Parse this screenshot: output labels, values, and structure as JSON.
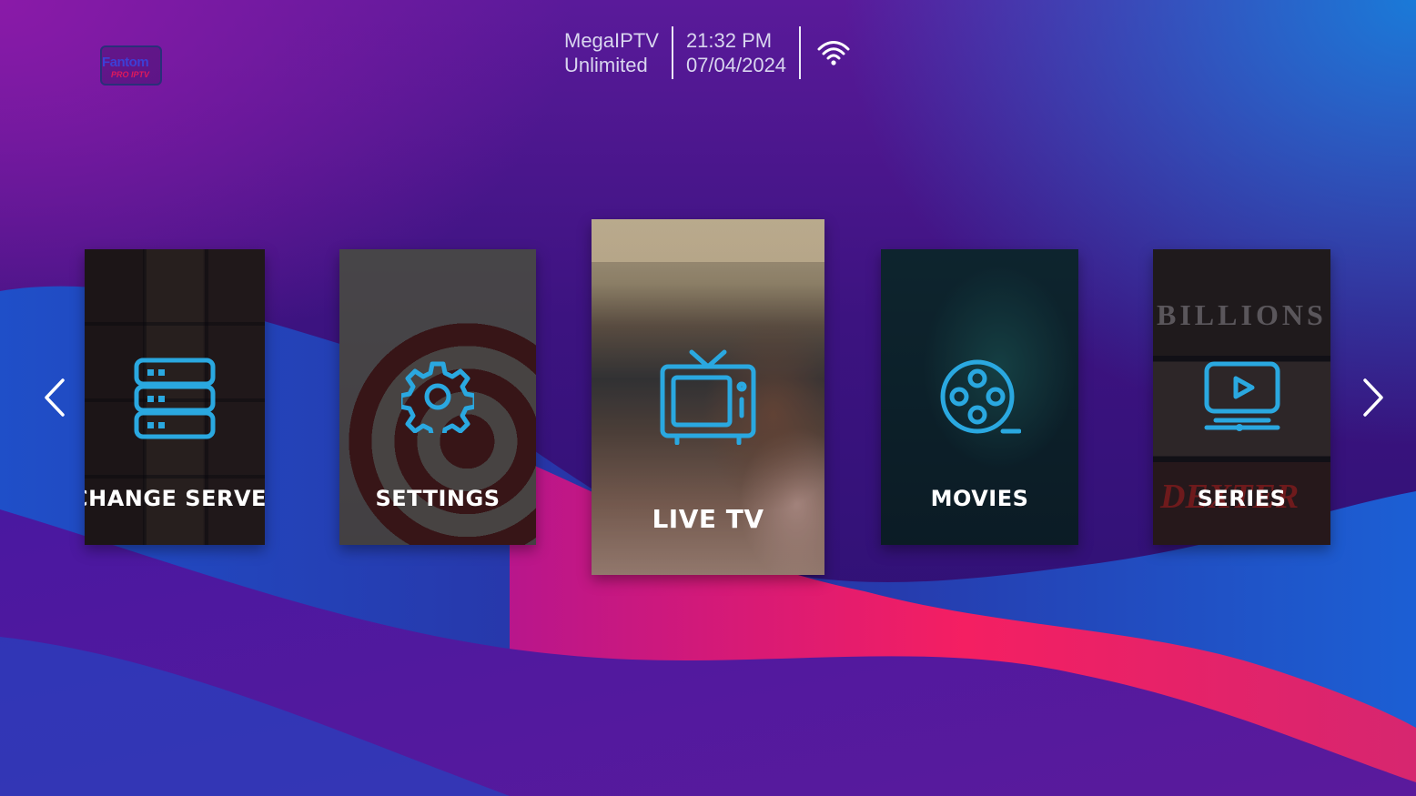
{
  "app": {
    "logo_text": "Fantom",
    "logo_sub": "PRO IPTV"
  },
  "status": {
    "provider": "MegaIPTV",
    "plan": "Unlimited",
    "time": "21:32 PM",
    "date": "07/04/2024",
    "network_icon": "wifi-icon"
  },
  "menu": [
    {
      "id": "change-server",
      "label": "CHANGE SERVER",
      "icon": "server-icon",
      "state": "normal"
    },
    {
      "id": "settings",
      "label": "SETTINGS",
      "icon": "gear-icon",
      "state": "normal"
    },
    {
      "id": "live-tv",
      "label": "LIVE TV",
      "icon": "tv-icon",
      "state": "focused"
    },
    {
      "id": "movies",
      "label": "MOVIES",
      "icon": "film-reel-icon",
      "state": "normal"
    },
    {
      "id": "series",
      "label": "SERIES",
      "icon": "play-screen-icon",
      "state": "normal"
    }
  ],
  "series_poster_texts": [
    "BILLIONS",
    "DEXTER"
  ],
  "nav": {
    "prev_icon": "chevron-left-icon",
    "next_icon": "chevron-right-icon"
  },
  "colors": {
    "icon_accent": "#2aa8e0",
    "wave_pink": "#ff2a6a",
    "wave_blue": "#1a5ed0"
  }
}
